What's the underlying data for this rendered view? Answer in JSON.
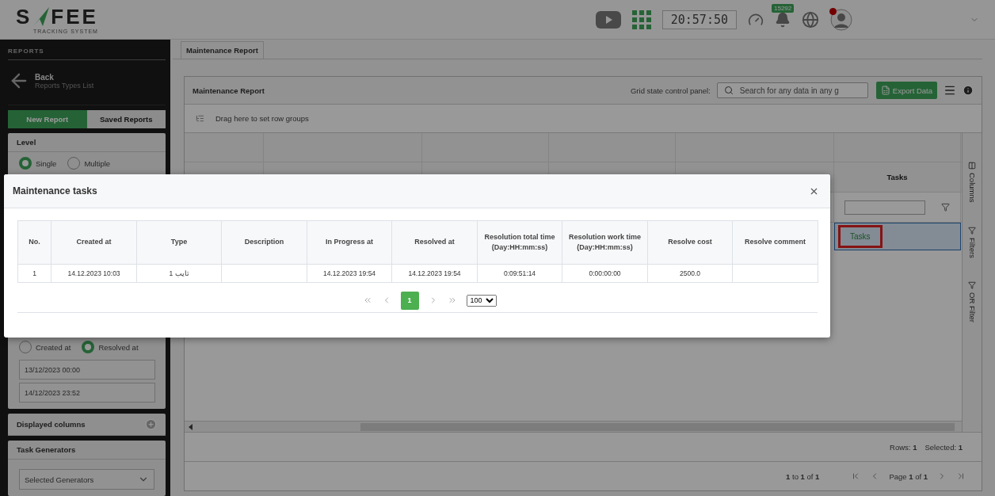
{
  "header": {
    "logo": {
      "letters_before": "S",
      "letters_after": "FEE",
      "tagline": "TRACKING SYSTEM"
    },
    "clock": "20:57:50",
    "notification_count": "15292",
    "user_online": true
  },
  "sidebar": {
    "section_title": "REPORTS",
    "back": {
      "label": "Back",
      "subtitle": "Reports Types List"
    },
    "tabs": [
      {
        "label": "New Report",
        "selected": true
      },
      {
        "label": "Saved Reports",
        "selected": false
      }
    ],
    "level": {
      "title": "Level",
      "options": [
        {
          "label": "Single",
          "selected": true
        },
        {
          "label": "Multiple",
          "selected": false
        }
      ]
    },
    "date_filter": {
      "options": [
        {
          "label": "Created at",
          "selected": false
        },
        {
          "label": "Resolved at",
          "selected": true
        }
      ],
      "from": "13/12/2023 00:00",
      "to": "14/12/2023 23:52"
    },
    "sections": [
      {
        "kind": "add",
        "title": "Displayed columns"
      },
      {
        "kind": "select",
        "title": "Task Generators",
        "placeholder": "Selected Generators"
      }
    ]
  },
  "report_tab": "Maintenance Report",
  "panel": {
    "title": "Maintenance Report",
    "control_label": "Grid state control panel:",
    "search_placeholder": "Search for any data in any g",
    "export_button": "Export Data",
    "row_group_hint": "Drag here to set row groups",
    "grid": {
      "header": "Tasks",
      "rows": [
        {
          "tasks": "Tasks",
          "selected": true,
          "highlighted": true
        }
      ]
    },
    "side_tabs": [
      "Columns",
      "Filters",
      "OR Filter"
    ],
    "status": {
      "rows": "Rows: **1**",
      "selected": "Selected: **1**"
    },
    "pager": {
      "range": "**1** to **1** of **1**",
      "page": "Page **1** of **1**"
    }
  },
  "modal": {
    "title": "Maintenance tasks",
    "columns": [
      "No.",
      "Created at",
      "Type",
      "Description",
      "In Progress at",
      "Resolved at",
      "Resolution total time (Day:HH:mm:ss)",
      "Resolution work time (Day:HH:mm:ss)",
      "Resolve cost",
      "Resolve comment"
    ],
    "rows": [
      {
        "no": "1",
        "created_at": "14.12.2023 10:03",
        "type": "1 تايب",
        "in_progress_at": "14.12.2023 19:54",
        "resolved_at": "14.12.2023 19:54",
        "total_time": "0:09:51:14",
        "work_time": "0:00:00:00",
        "cost": "2500.0"
      }
    ],
    "pages": [
      {
        "label": "1",
        "selected": true
      }
    ],
    "page_size": "100"
  }
}
